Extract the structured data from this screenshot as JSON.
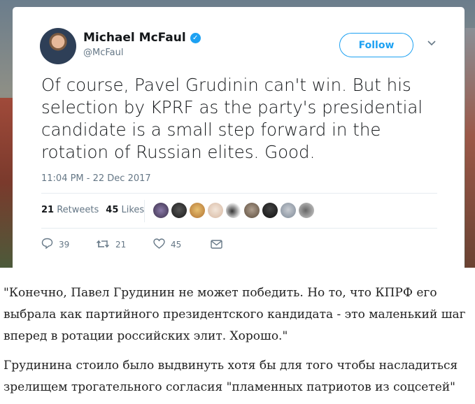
{
  "tweet": {
    "author_name": "Michael McFaul",
    "handle": "@McFaul",
    "follow_label": "Follow",
    "text": "Of course, Pavel Grudinin can't win. But his\nselection by KPRF as the party's presidential\ncandidate is a small step forward in the\nrotation of Russian elites.  Good.",
    "timestamp": "11:04 PM - 22 Dec 2017",
    "retweets_count": "21",
    "retweets_label": "Retweets",
    "likes_count": "45",
    "likes_label": "Likes",
    "reply_count": "39",
    "retweet_action_count": "21",
    "like_action_count": "45",
    "colors": {
      "accent": "#1da1f2",
      "muted": "#657786",
      "text": "#14171a"
    },
    "icons": {
      "verified": "verified-badge-icon",
      "reply": "reply-icon",
      "retweet": "retweet-icon",
      "like": "heart-icon",
      "message": "envelope-icon",
      "caret": "chevron-down-icon"
    }
  },
  "article": {
    "paragraph1": "\"Конечно, Павел Грудинин не может победить. Но то, что КПРФ его выбрала как партийного президентского кандидата - это маленький шаг вперед в ротации российских элит. Хорошо.\"",
    "paragraph2": "Грудинина стоило было выдвинуть хотя бы для того чтобы насладиться зрелищем трогательного согласия \"пламенных патриотов из соцсетей\""
  }
}
